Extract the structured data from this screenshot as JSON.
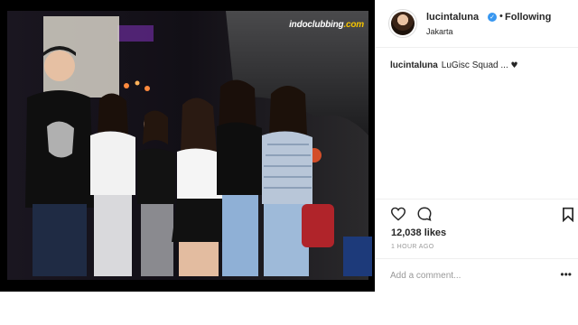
{
  "photo": {
    "watermark_main": "indoclubbing",
    "watermark_suffix": ".com"
  },
  "header": {
    "username": "lucintaluna",
    "verified_icon": "verified-badge-icon",
    "separator": "•",
    "follow_status": "Following",
    "location": "Jakarta"
  },
  "caption": {
    "username": "lucintaluna",
    "text": "LuGisc Squad ...",
    "emoji": "♥"
  },
  "actions": {
    "like_icon": "heart-icon",
    "comment_icon": "comment-icon",
    "save_icon": "bookmark-icon"
  },
  "stats": {
    "likes": "12,038 likes",
    "time": "1 HOUR AGO"
  },
  "comment": {
    "placeholder": "Add a comment...",
    "more": "•••"
  },
  "colors": {
    "verified": "#3897f0",
    "border": "#efefef",
    "muted": "#999999"
  }
}
